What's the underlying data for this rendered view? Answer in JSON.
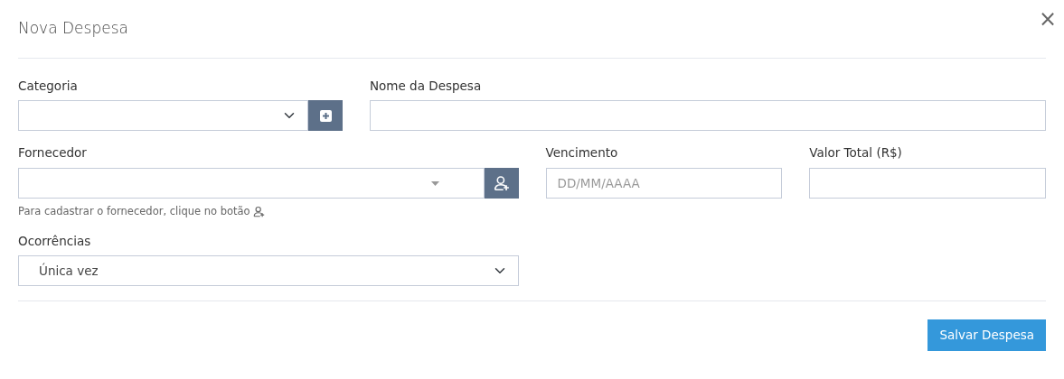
{
  "modal": {
    "title": "Nova Despesa",
    "close": "×"
  },
  "rows": [
    {
      "fields": [
        {
          "kind": "select-button",
          "label": "Categoria"
        },
        {
          "kind": "text",
          "label": "Nome da Despesa"
        }
      ]
    },
    {
      "fields": [
        {
          "kind": "combo-button",
          "label": "Fornecedor",
          "hint": "Para cadastrar o fornecedor, clique no botão"
        },
        {
          "kind": "text",
          "label": "Vencimento",
          "placeholder": "DD/MM/AAAA"
        },
        {
          "kind": "text",
          "label": "Valor Total (R$)"
        }
      ]
    },
    {
      "fields": [
        {
          "kind": "select",
          "label": "Ocorrências",
          "value": "Única vez"
        }
      ]
    }
  ],
  "footer": {
    "button": "Salvar Despesa"
  }
}
